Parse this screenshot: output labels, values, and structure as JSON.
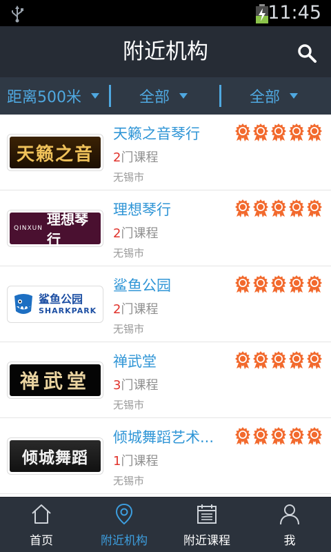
{
  "status_bar": {
    "time": "11:45"
  },
  "header": {
    "title": "附近机构"
  },
  "filters": [
    {
      "label": "距离500米"
    },
    {
      "label": "全部"
    },
    {
      "label": "全部"
    }
  ],
  "institutions": [
    {
      "name": "天籁之音琴行",
      "course_count": "2",
      "course_unit": "门课程",
      "city": "无锡市",
      "logo_text": "天籁之音",
      "rating": 5
    },
    {
      "name": "理想琴行",
      "course_count": "2",
      "course_unit": "门课程",
      "city": "无锡市",
      "logo_text": "理想琴行",
      "logo_brand": "QINXUN",
      "rating": 5
    },
    {
      "name": "鲨鱼公园",
      "course_count": "2",
      "course_unit": "门课程",
      "city": "无锡市",
      "logo_text": "鲨鱼公园",
      "logo_text_en": "SHARKPARK",
      "rating": 5
    },
    {
      "name": "禅武堂",
      "course_count": "3",
      "course_unit": "门课程",
      "city": "无锡市",
      "logo_text": "禅武堂",
      "rating": 5
    },
    {
      "name": "倾城舞蹈艺术...",
      "course_count": "1",
      "course_unit": "门课程",
      "city": "无锡市",
      "logo_text": "倾城舞蹈",
      "rating": 5
    }
  ],
  "bottom_nav": [
    {
      "label": "首页",
      "icon": "home-icon",
      "active": false
    },
    {
      "label": "附近机构",
      "icon": "location-pin-icon",
      "active": true
    },
    {
      "label": "附近课程",
      "icon": "calendar-icon",
      "active": false
    },
    {
      "label": "我",
      "icon": "person-icon",
      "active": false
    }
  ],
  "colors": {
    "accent": "#3d9fe0",
    "header_bg": "#262c35",
    "filter_bg": "#2f3945",
    "course_count": "#e0322b",
    "rating_badge": "#f26a2e"
  }
}
